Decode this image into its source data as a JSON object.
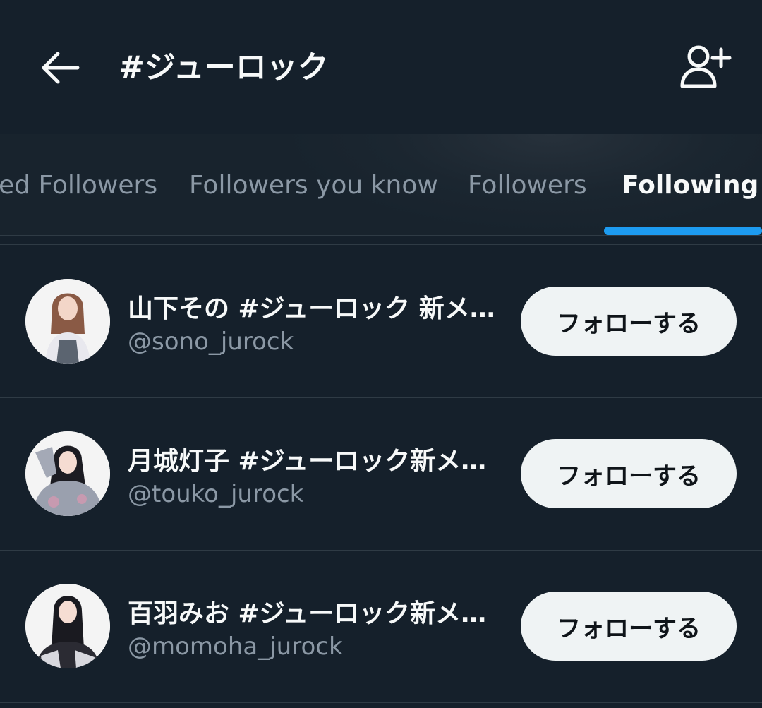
{
  "header": {
    "title": "#ジューロック",
    "back_icon": "arrow-left-icon",
    "add_user_icon": "person-add-icon"
  },
  "tabs": [
    {
      "label": "ed Followers",
      "active": false
    },
    {
      "label": "Followers you know",
      "active": false
    },
    {
      "label": "Followers",
      "active": false
    },
    {
      "label": "Following",
      "active": true
    }
  ],
  "users": [
    {
      "name": "山下その #ジューロック 新メ…",
      "handle": "@sono_jurock",
      "button": "フォローする"
    },
    {
      "name": "月城灯子 #ジューロック新メ…",
      "handle": "@touko_jurock",
      "button": "フォローする"
    },
    {
      "name": "百羽みお #ジューロック新メ…",
      "handle": "@momoha_jurock",
      "button": "フォローする"
    }
  ],
  "colors": {
    "background": "#15202b",
    "accent": "#1d9bf0",
    "secondary_text": "#8b98a5",
    "button_bg": "#eff3f4"
  }
}
